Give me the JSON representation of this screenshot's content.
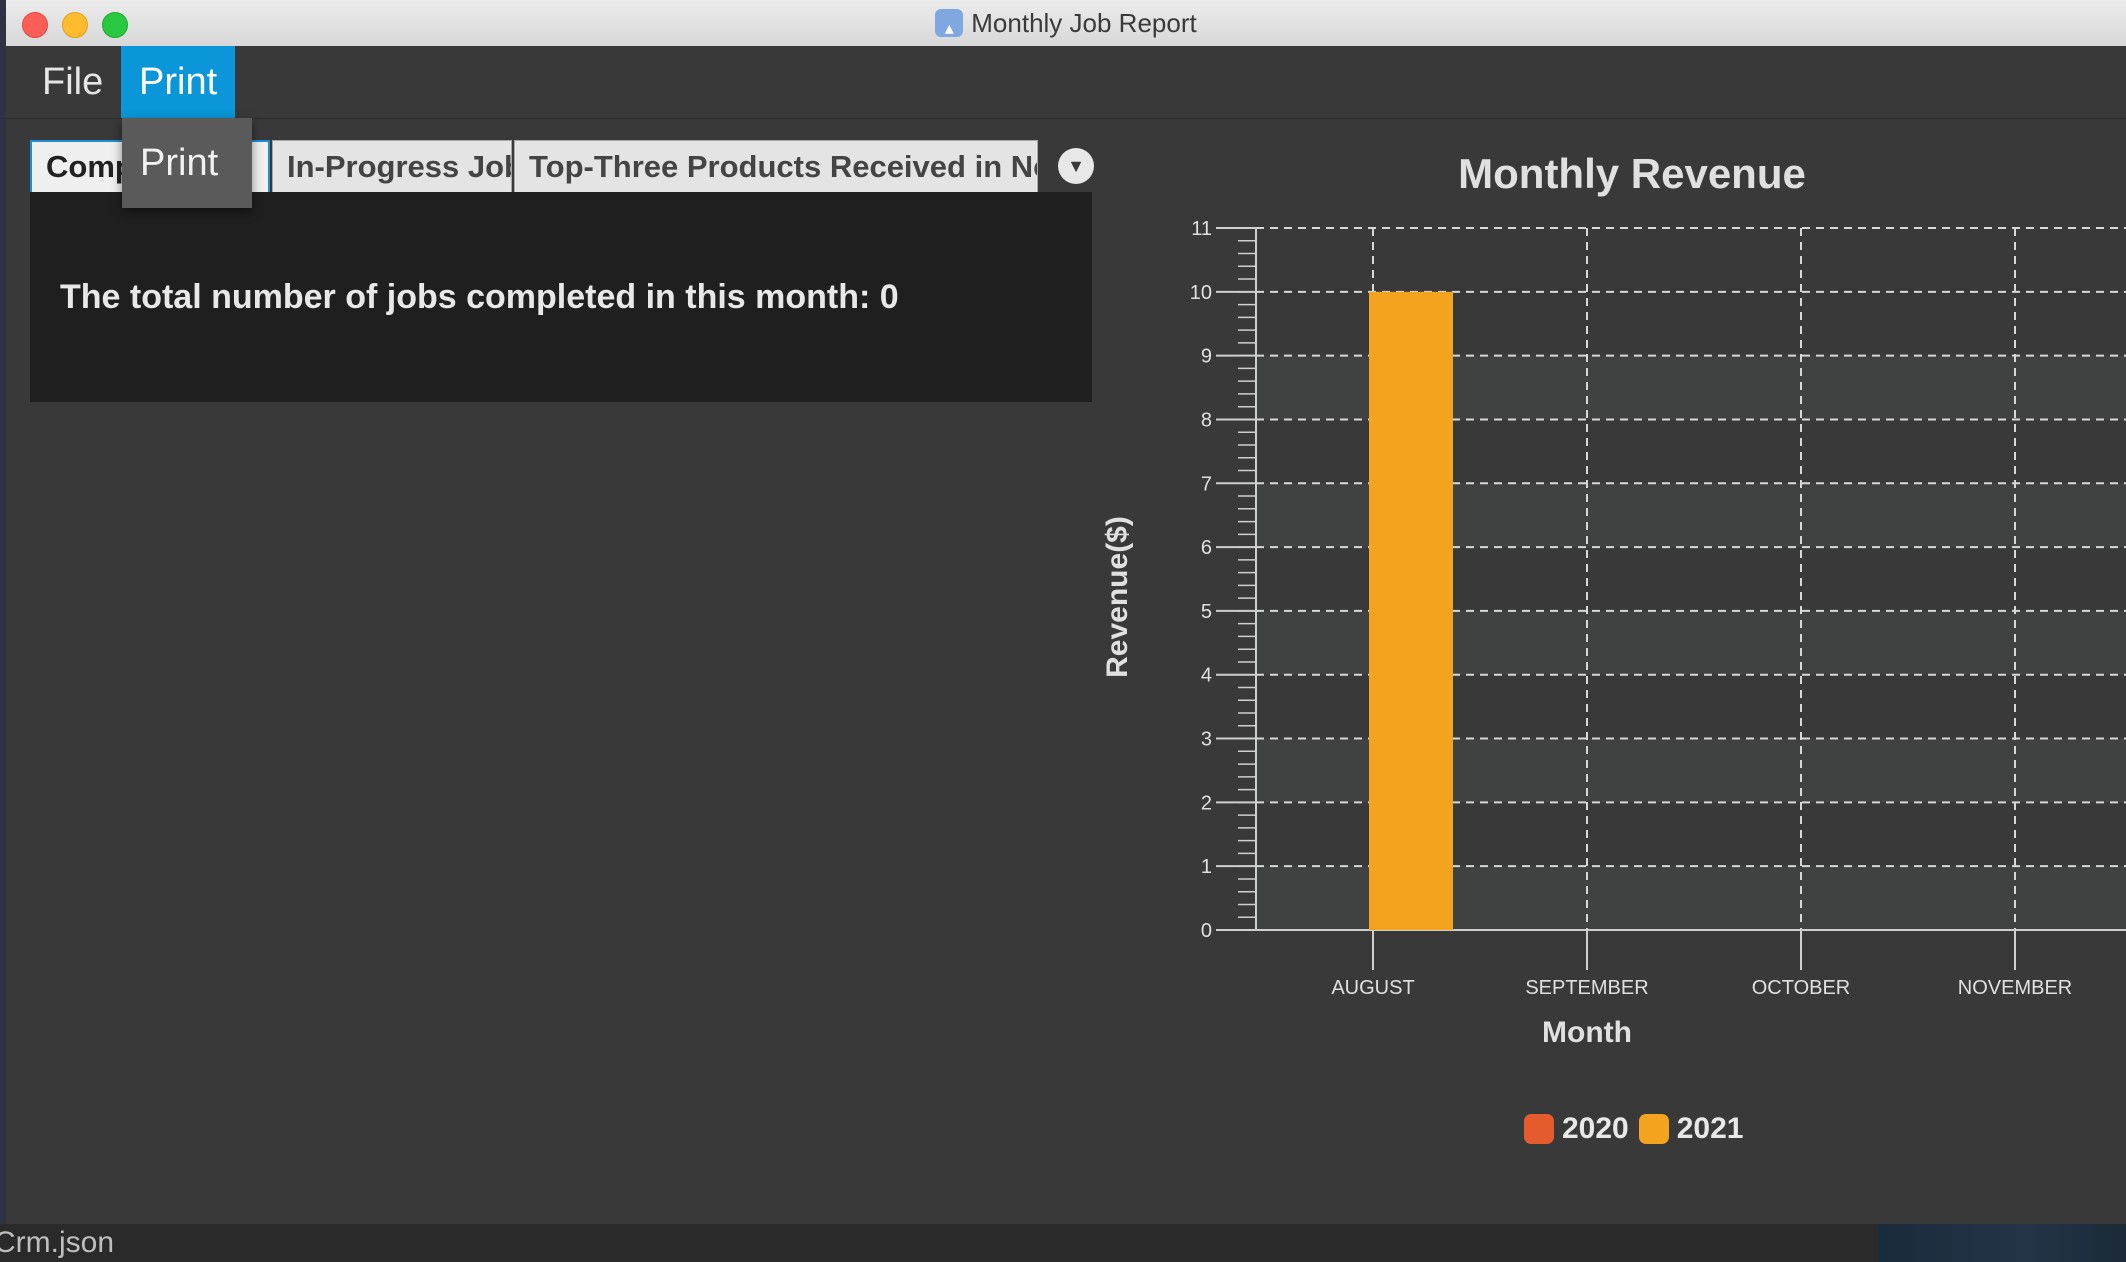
{
  "window": {
    "title": "Monthly Job Report"
  },
  "menubar": {
    "file_label": "File",
    "print_label": "Print",
    "dropdown": {
      "print_item": "Print"
    }
  },
  "tabs": [
    {
      "label": "Completed Job",
      "visible_label": "Comp"
    },
    {
      "label": "In-Progress Job"
    },
    {
      "label": "Top-Three Products Received in Nov"
    }
  ],
  "panel": {
    "text": "The total number of jobs completed in this month: 0"
  },
  "statusbar": {
    "text": "Crm.json"
  },
  "colors": {
    "accent": "#0a96d8",
    "series_2020": "#e45b2e",
    "series_2021": "#f4a31f"
  },
  "chart_data": {
    "type": "bar",
    "title": "Monthly Revenue",
    "xlabel": "Month",
    "ylabel": "Revenue($)",
    "categories": [
      "AUGUST",
      "SEPTEMBER",
      "OCTOBER",
      "NOVEMBER"
    ],
    "ylim": [
      0,
      11
    ],
    "yticks": [
      0,
      1,
      2,
      3,
      4,
      5,
      6,
      7,
      8,
      9,
      10,
      11
    ],
    "grid": true,
    "legend": "bottom",
    "series": [
      {
        "name": "2020",
        "color": "#e45b2e",
        "values": [
          0,
          0,
          0,
          0
        ]
      },
      {
        "name": "2021",
        "color": "#f4a31f",
        "values": [
          10,
          0,
          0,
          0
        ]
      }
    ]
  }
}
